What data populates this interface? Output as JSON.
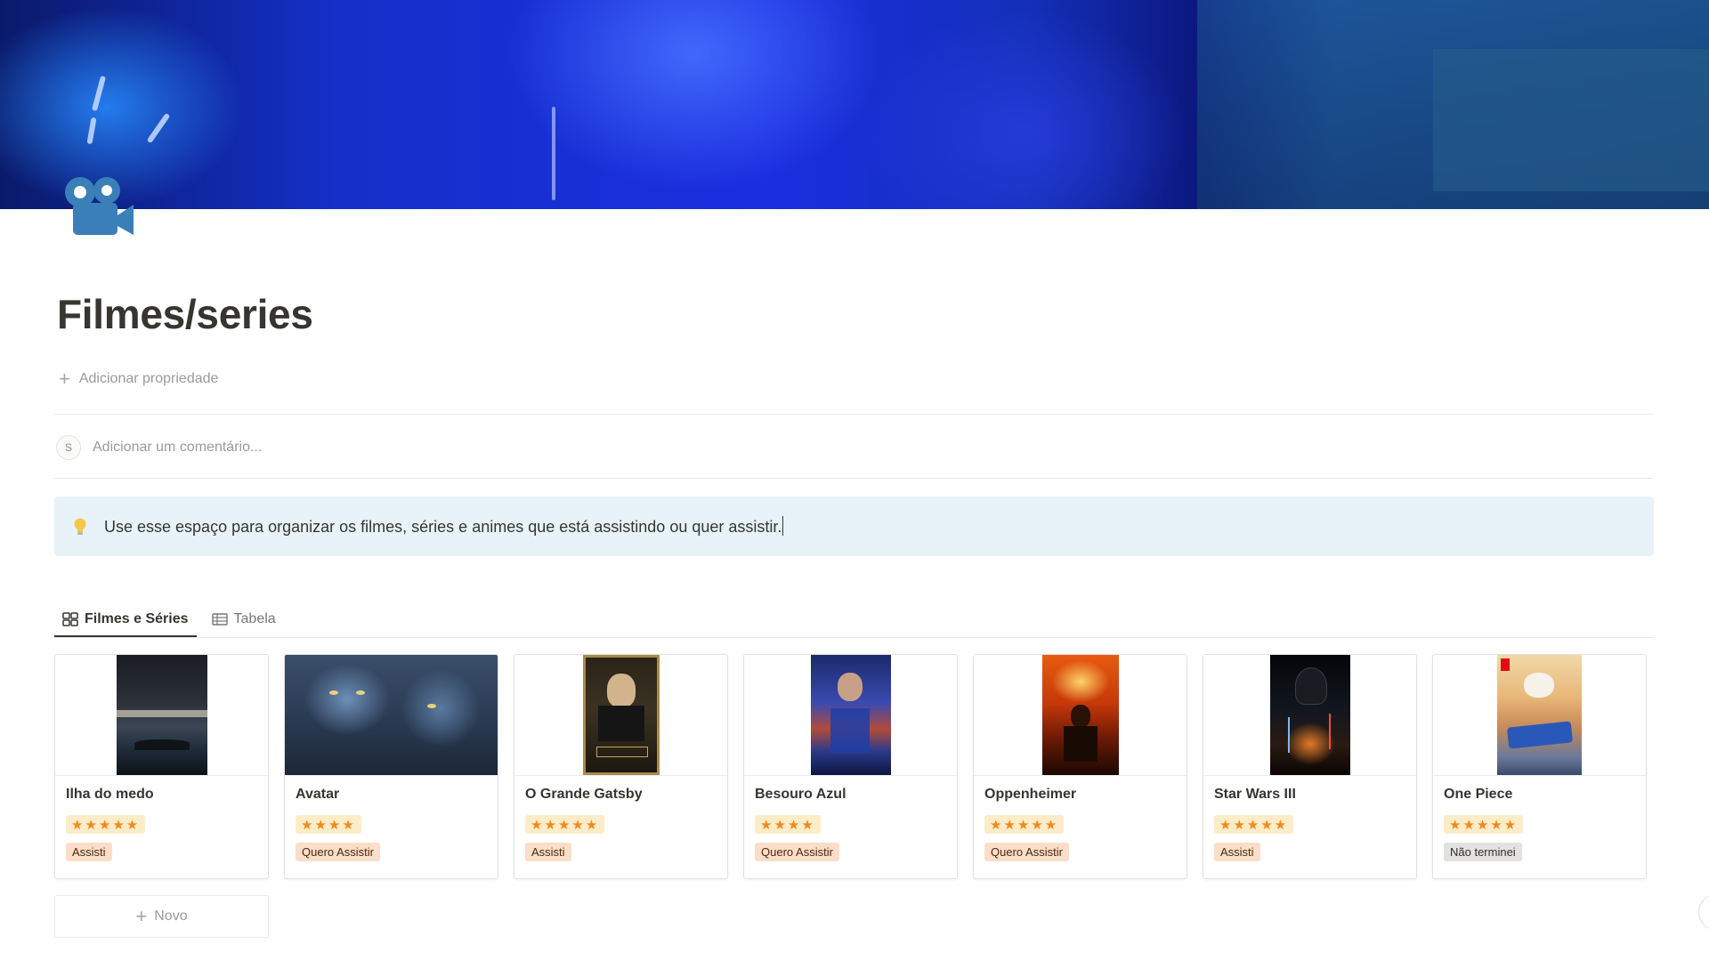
{
  "page": {
    "title": "Filmes/series",
    "add_property_label": "Adicionar propriedade",
    "comment_placeholder": "Adicionar um comentário...",
    "avatar_initial": "S",
    "callout_text": "Use esse espaço para organizar os filmes, séries e animes que está assistindo ou quer assistir.",
    "new_label": "Novo"
  },
  "tabs": [
    {
      "label": "Filmes e Séries",
      "icon": "gallery-icon",
      "active": true
    },
    {
      "label": "Tabela",
      "icon": "table-icon",
      "active": false
    }
  ],
  "cards": [
    {
      "title": "Ilha do medo",
      "stars": "★★★★★",
      "rating": 5,
      "status": "Assisti",
      "poster": "poster-ilha-do-medo"
    },
    {
      "title": "Avatar",
      "stars": "★★★★",
      "rating": 4,
      "status": "Quero Assistir",
      "poster": "poster-avatar"
    },
    {
      "title": "O Grande Gatsby",
      "stars": "★★★★★",
      "rating": 5,
      "status": "Assisti",
      "poster": "poster-gatsby"
    },
    {
      "title": "Besouro Azul",
      "stars": "★★★★",
      "rating": 4,
      "status": "Quero Assistir",
      "poster": "poster-besouro-azul"
    },
    {
      "title": "Oppenheimer",
      "stars": "★★★★★",
      "rating": 5,
      "status": "Quero Assistir",
      "poster": "poster-oppenheimer"
    },
    {
      "title": "Star Wars III",
      "stars": "★★★★★",
      "rating": 5,
      "status": "Assisti",
      "poster": "poster-star-wars"
    },
    {
      "title": "One Piece",
      "stars": "★★★★★",
      "rating": 5,
      "status": "Não terminei",
      "poster": "poster-one-piece"
    }
  ],
  "colors": {
    "status_orange_bg": "#fadec9",
    "status_orange_fg": "#49290e",
    "status_gray_bg": "#e3e2e0",
    "status_gray_fg": "#32302c",
    "rating_bg": "#fdecc8",
    "star": "#f08a1c",
    "callout_bg": "#e7f3f8",
    "page_icon": "#3a7fb8"
  }
}
